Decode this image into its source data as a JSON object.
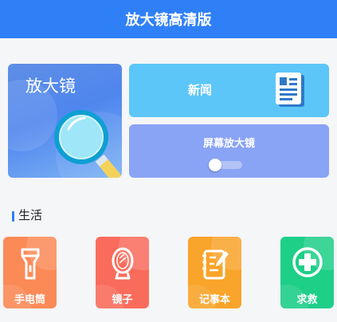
{
  "header": {
    "title": "放大镜高清版"
  },
  "cards": {
    "magnifier": {
      "label": "放大镜"
    },
    "news": {
      "label": "新闻",
      "icon": "newspaper-icon"
    },
    "screen_magnifier": {
      "label": "屏幕放大镜",
      "toggle_on": false
    }
  },
  "section": {
    "title": "生活"
  },
  "tools": [
    {
      "label": "手电筒",
      "icon": "flashlight-icon",
      "color": "#fb8a57"
    },
    {
      "label": "镜子",
      "icon": "mirror-icon",
      "color": "#f96c5c"
    },
    {
      "label": "记事本",
      "icon": "notepad-icon",
      "color": "#f9a42a"
    },
    {
      "label": "求救",
      "icon": "first-aid-cross-icon",
      "color": "#1ecf88"
    }
  ],
  "colors": {
    "header": "#2f80f7",
    "news_card": "#5cc6f8",
    "screen_card": "#89a3f5"
  }
}
